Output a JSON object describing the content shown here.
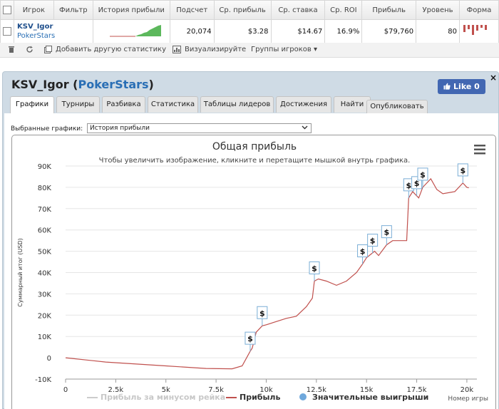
{
  "table": {
    "headers": [
      "Игрок",
      "Фильтр",
      "История прибыли",
      "Подсчет",
      "Ср. прибыль",
      "Ср. ставка",
      "Ср. ROI",
      "Прибыль",
      "Уровень",
      "Форма"
    ],
    "row": {
      "player": "KSV_Igor",
      "site": "PokerStars",
      "count": "20,074",
      "avg_profit": "$3.28",
      "avg_stake": "$14.67",
      "avg_roi": "16.9%",
      "profit": "$79,760",
      "level": "80"
    }
  },
  "toolbar": {
    "add_stats": "Добавить другую статистику",
    "visualize": "Визуализируйте",
    "groups": "Группы игроков"
  },
  "panel": {
    "player": "KSV_Igor",
    "site": "PokerStars",
    "like_label": "Like 0",
    "close": "×",
    "tabs": [
      "Графики",
      "Турниры",
      "Разбивка",
      "Статистика",
      "Таблицы лидеров",
      "Достижения",
      "Найти"
    ],
    "publish": "Опубликовать",
    "selected_label": "Выбранные графики:",
    "selected_value": "История прибыли"
  },
  "chart_data": {
    "type": "line",
    "title": "Общая прибыль",
    "subtitle": "Чтобы увеличить изображение, кликните и перетащите мышкой внутрь графика.",
    "xlabel": "Номер игры",
    "ylabel": "Суммарный итог (USD)",
    "xlim": [
      0,
      20500
    ],
    "ylim": [
      -10000,
      90000
    ],
    "x_ticks": [
      "0",
      "2.5k",
      "5k",
      "7.5k",
      "10k",
      "12.5k",
      "15k",
      "17.5k",
      "20k"
    ],
    "y_ticks": [
      "-10K",
      "0",
      "10K",
      "20K",
      "30K",
      "40K",
      "50K",
      "60K",
      "70K",
      "80K",
      "90K"
    ],
    "series": [
      {
        "name": "Прибыль",
        "color": "#c0504d",
        "x": [
          0,
          2000,
          5000,
          7000,
          8300,
          8800,
          9200,
          9300,
          9500,
          9800,
          10000,
          10500,
          11000,
          11500,
          12000,
          12300,
          12400,
          12600,
          13000,
          13500,
          14000,
          14500,
          14800,
          15000,
          15400,
          15600,
          16000,
          16300,
          16800,
          17000,
          17100,
          17300,
          17600,
          17800,
          18200,
          18500,
          18800,
          19400,
          19800,
          20000,
          20100
        ],
        "values": [
          0,
          -2000,
          -3800,
          -5000,
          -5200,
          -3800,
          3000,
          4500,
          12000,
          15000,
          15500,
          17000,
          18500,
          19500,
          24000,
          28000,
          36000,
          37000,
          36000,
          34000,
          36000,
          40000,
          44000,
          47000,
          50000,
          48000,
          53000,
          55000,
          55000,
          55000,
          75000,
          78000,
          75000,
          80000,
          84000,
          79000,
          77000,
          78000,
          82000,
          80000,
          79760
        ]
      }
    ],
    "legend": [
      {
        "label": "Прибыль за минусом рейка",
        "color": "#cccccc",
        "type": "line"
      },
      {
        "label": "Прибыль",
        "color": "#c0504d",
        "type": "line"
      },
      {
        "label": "Значительные выигрыши",
        "color": "#6fa8dc",
        "type": "dot"
      }
    ],
    "big_wins": [
      {
        "x": 9200,
        "y": 3000
      },
      {
        "x": 9800,
        "y": 15000
      },
      {
        "x": 12400,
        "y": 36000
      },
      {
        "x": 14800,
        "y": 44000
      },
      {
        "x": 15300,
        "y": 49000
      },
      {
        "x": 16000,
        "y": 53000
      },
      {
        "x": 17100,
        "y": 75000
      },
      {
        "x": 17500,
        "y": 76000
      },
      {
        "x": 17800,
        "y": 80000
      },
      {
        "x": 19800,
        "y": 82000
      }
    ],
    "big_win_marker": "$"
  }
}
